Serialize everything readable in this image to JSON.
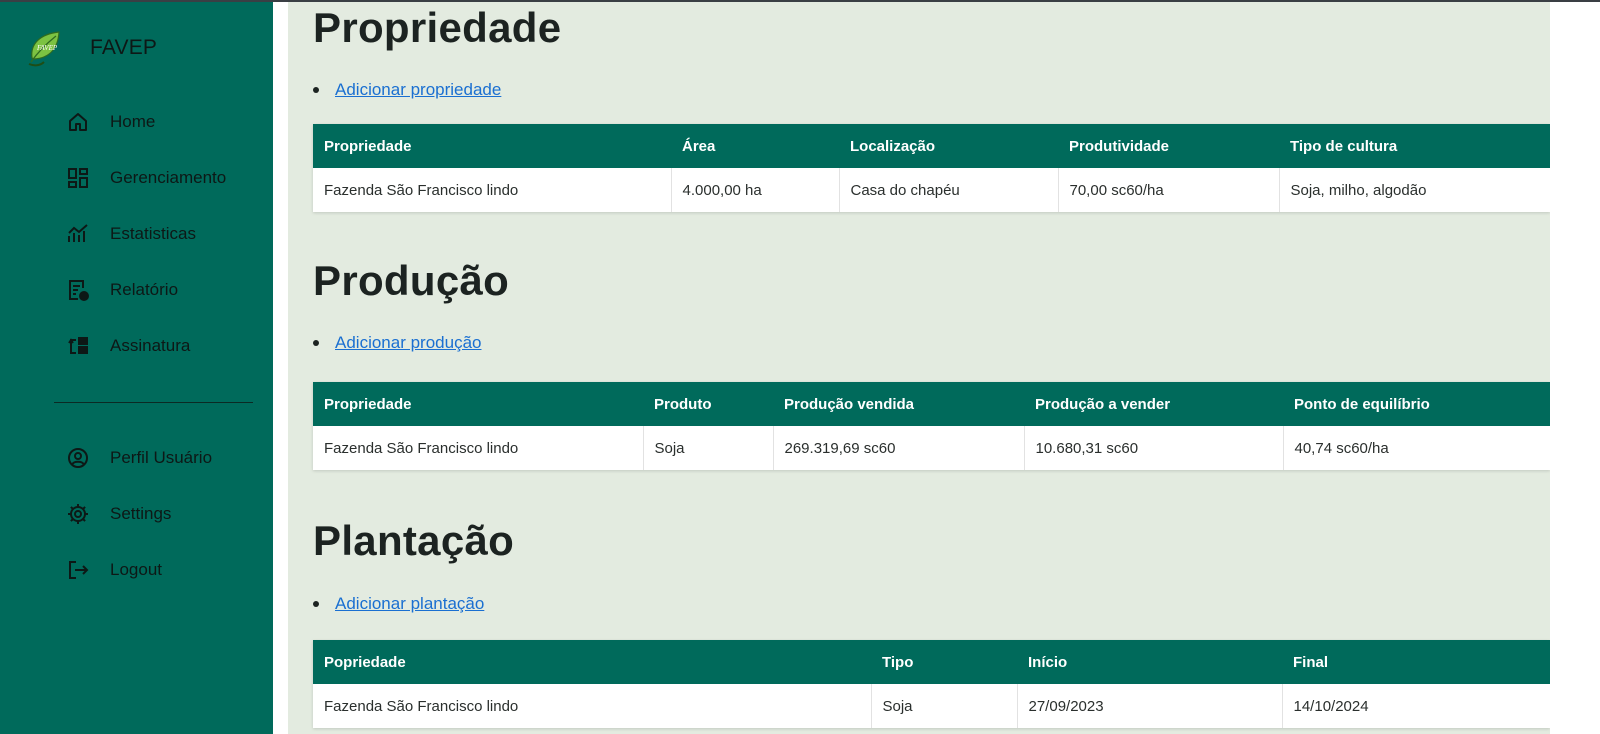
{
  "app": {
    "name": "FAVEP",
    "logo_text": "FAVEP"
  },
  "sidebar": {
    "items": [
      {
        "label": "Home",
        "icon": "home-icon"
      },
      {
        "label": "Gerenciamento",
        "icon": "dashboard-icon"
      },
      {
        "label": "Estatisticas",
        "icon": "chart-icon"
      },
      {
        "label": "Relatório",
        "icon": "report-icon"
      },
      {
        "label": "Assinatura",
        "icon": "subscription-icon"
      }
    ],
    "bottom_items": [
      {
        "label": "Perfil Usuário",
        "icon": "user-icon"
      },
      {
        "label": "Settings",
        "icon": "gear-icon"
      },
      {
        "label": "Logout",
        "icon": "logout-icon"
      }
    ]
  },
  "sections": {
    "propriedade": {
      "title": "Propriedade",
      "add_link": "Adicionar propriedade",
      "headers": [
        "Propriedade",
        "Área",
        "Localização",
        "Produtividade",
        "Tipo de cultura"
      ],
      "rows": [
        [
          "Fazenda São Francisco lindo",
          "4.000,00 ha",
          "Casa do chapéu",
          "70,00 sc60/ha",
          "Soja, milho, algodão"
        ]
      ]
    },
    "producao": {
      "title": "Produção",
      "add_link": "Adicionar produção",
      "headers": [
        "Propriedade",
        "Produto",
        "Produção vendida",
        "Produção a vender",
        "Ponto de equilíbrio"
      ],
      "rows": [
        [
          "Fazenda São Francisco lindo",
          "Soja",
          "269.319,69 sc60",
          "10.680,31 sc60",
          "40,74 sc60/ha"
        ]
      ]
    },
    "plantacao": {
      "title": "Plantação",
      "add_link": "Adicionar plantação",
      "headers": [
        "Popriedade",
        "Tipo",
        "Início",
        "Final"
      ],
      "rows": [
        [
          "Fazenda São Francisco lindo",
          "Soja",
          "27/09/2023",
          "14/10/2024"
        ]
      ]
    }
  },
  "colors": {
    "sidebar": "#006a5b",
    "table_header": "#006a5b",
    "content_bg": "#e3ebe0",
    "link": "#1a6fd1"
  }
}
